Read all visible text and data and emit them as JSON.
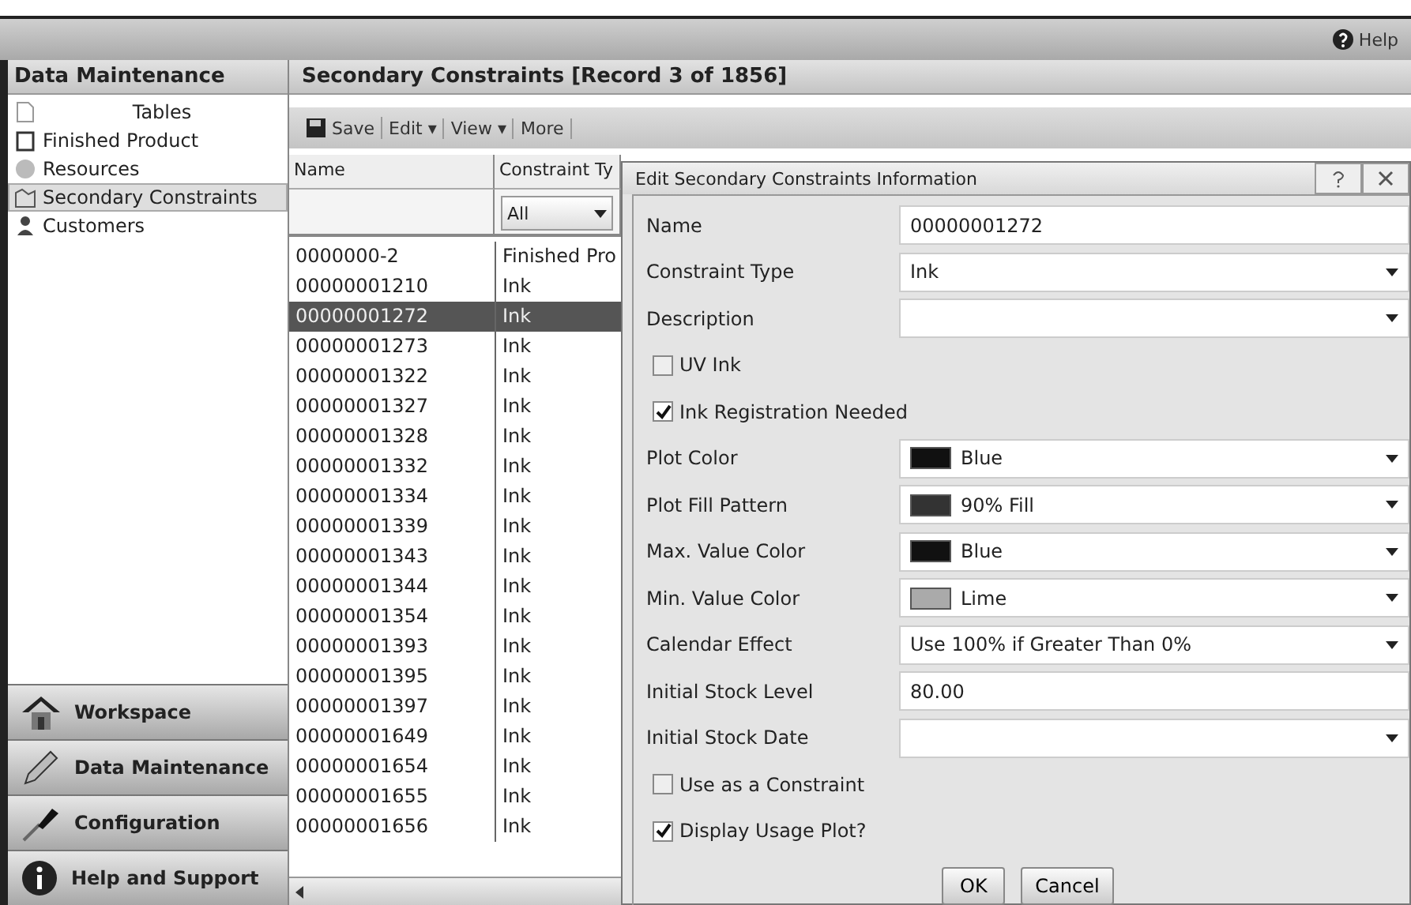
{
  "top_bar": {
    "help": "Help"
  },
  "sidebar": {
    "title": "Data Maintenance",
    "items": [
      {
        "label": "Tables",
        "kind": "heading",
        "selected": false
      },
      {
        "label": "Finished Product",
        "kind": "item",
        "selected": false
      },
      {
        "label": "Resources",
        "kind": "item",
        "selected": false
      },
      {
        "label": "Secondary Constraints",
        "kind": "item",
        "selected": true
      },
      {
        "label": "Customers",
        "kind": "item",
        "selected": false
      }
    ],
    "nav": [
      {
        "label": "Workspace"
      },
      {
        "label": "Data Maintenance"
      },
      {
        "label": "Configuration"
      },
      {
        "label": "Help and Support"
      }
    ]
  },
  "main": {
    "title": "Secondary Constraints [Record 3 of 1856]",
    "toolbar": [
      {
        "label": "Save",
        "kind": "save"
      },
      {
        "label": "Edit ▾",
        "kind": "menu"
      },
      {
        "label": "View ▾",
        "kind": "menu"
      },
      {
        "label": "More",
        "kind": "menu"
      }
    ],
    "table": {
      "columns": [
        "Name",
        "Constraint Ty"
      ],
      "filter": "All",
      "rows": [
        {
          "name": "0000000-2",
          "type": "Finished Pro",
          "selected": false
        },
        {
          "name": "00000001210",
          "type": "Ink",
          "selected": false
        },
        {
          "name": "00000001272",
          "type": "Ink",
          "selected": true
        },
        {
          "name": "00000001273",
          "type": "Ink",
          "selected": false
        },
        {
          "name": "00000001322",
          "type": "Ink",
          "selected": false
        },
        {
          "name": "00000001327",
          "type": "Ink",
          "selected": false
        },
        {
          "name": "00000001328",
          "type": "Ink",
          "selected": false
        },
        {
          "name": "00000001332",
          "type": "Ink",
          "selected": false
        },
        {
          "name": "00000001334",
          "type": "Ink",
          "selected": false
        },
        {
          "name": "00000001339",
          "type": "Ink",
          "selected": false
        },
        {
          "name": "00000001343",
          "type": "Ink",
          "selected": false
        },
        {
          "name": "00000001344",
          "type": "Ink",
          "selected": false
        },
        {
          "name": "00000001354",
          "type": "Ink",
          "selected": false
        },
        {
          "name": "00000001393",
          "type": "Ink",
          "selected": false
        },
        {
          "name": "00000001395",
          "type": "Ink",
          "selected": false
        },
        {
          "name": "00000001397",
          "type": "Ink",
          "selected": false
        },
        {
          "name": "00000001649",
          "type": "Ink",
          "selected": false
        },
        {
          "name": "00000001654",
          "type": "Ink",
          "selected": false
        },
        {
          "name": "00000001655",
          "type": "Ink",
          "selected": false
        },
        {
          "name": "00000001656",
          "type": "Ink",
          "selected": false
        }
      ]
    }
  },
  "dialog": {
    "title": "Edit Secondary Constraints Information",
    "fields": [
      {
        "kind": "text",
        "label": "Name",
        "value": "00000001272"
      },
      {
        "kind": "select",
        "label": "Constraint Type",
        "value": "Ink"
      },
      {
        "kind": "select",
        "label": "Description"
      },
      {
        "kind": "check",
        "label": "UV Ink",
        "checked": false
      },
      {
        "kind": "check",
        "label": "Ink Registration Needed",
        "checked": true
      },
      {
        "kind": "swatch",
        "label": "Plot Color",
        "value": "Blue",
        "color": "#111111"
      },
      {
        "kind": "swatch",
        "label": "Plot Fill Pattern",
        "value": "90% Fill",
        "color": "#333333"
      },
      {
        "kind": "swatch",
        "label": "Max. Value Color",
        "value": "Blue",
        "color": "#111111"
      },
      {
        "kind": "swatch",
        "label": "Min. Value Color",
        "value": "Lime",
        "color": "#aaaaaa"
      },
      {
        "kind": "select",
        "label": "Calendar Effect",
        "value": "Use 100% if Greater Than 0%"
      },
      {
        "kind": "text",
        "label": "Initial Stock Level",
        "value": "80.00"
      },
      {
        "kind": "select",
        "label": "Initial Stock Date"
      },
      {
        "kind": "check",
        "label": "Use as a Constraint",
        "checked": false
      },
      {
        "kind": "check",
        "label": "Display Usage Plot?",
        "checked": true
      }
    ],
    "buttons": [
      "OK",
      "Cancel"
    ]
  }
}
